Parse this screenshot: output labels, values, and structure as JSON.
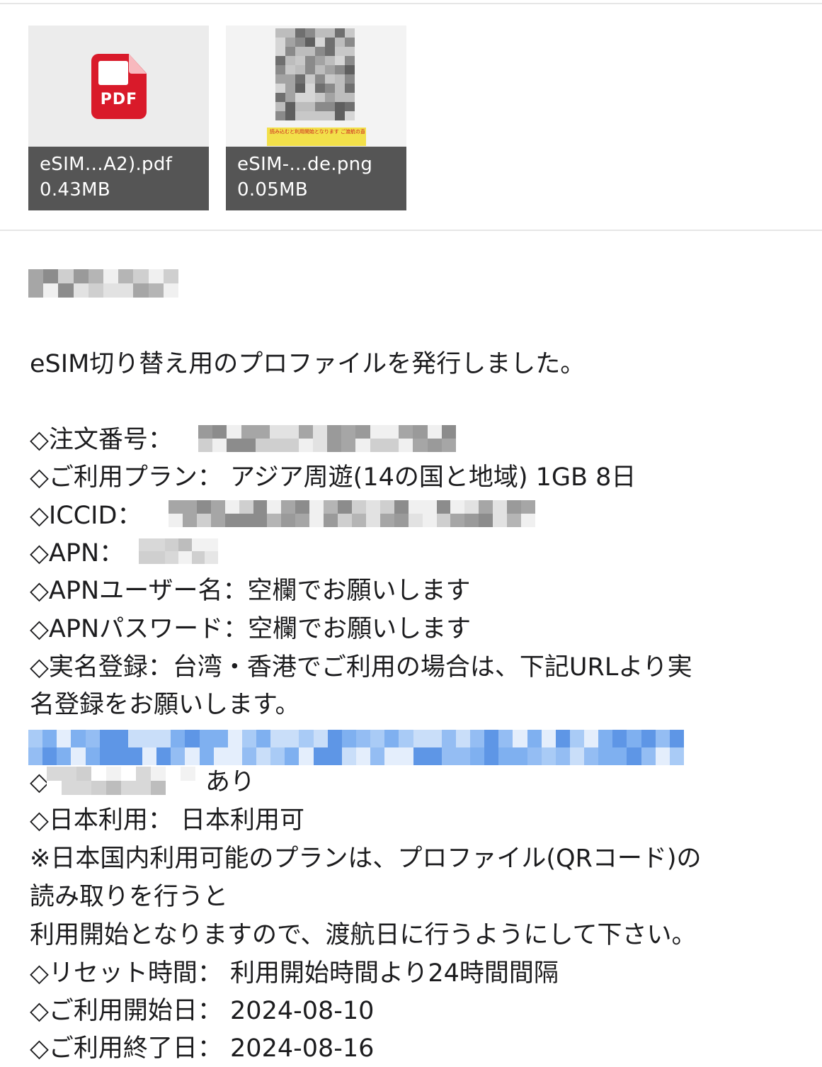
{
  "attachments": [
    {
      "type": "pdf",
      "icon": "pdf-icon",
      "icon_label": "PDF",
      "name": "eSIM…A2).pdf",
      "size": "0.43MB"
    },
    {
      "type": "png",
      "icon": "image-thumbnail",
      "name": "eSIM-...de.png",
      "size": "0.05MB",
      "preview_caption": "読み込むと利用開始となります ご渡航の直前直後に設定して下さい"
    }
  ],
  "message": {
    "intro": "eSIM切り替え用のプロファイルを発行しました。",
    "lines": [
      "◇注文番号：",
      "◇ご利用プラン： アジア周遊(14の国と地域) 1GB 8日",
      "◇ICCID：",
      "◇APN：",
      "◇APNユーザー名：空欄でお願いします",
      "◇APNパスワード：空欄でお願いします",
      "◇実名登録：台湾・香港でご利用の場合は、下記URLより実",
      "名登録をお願いします。",
      "◇テザリング： あり",
      "◇日本利用： 日本利用可",
      "※日本国内利用可能のプランは、プロファイル(QRコード)の",
      "読み取りを行うと",
      "利用開始となりますので、渡航日に行うようにして下さい。",
      "◇リセット時間： 利用開始時間より24時間間隔",
      "◇ご利用開始日： 2024-08-10",
      "◇ご利用終了日： 2024-08-16"
    ]
  },
  "colors": {
    "pdf_red": "#d91a2a",
    "attachment_footer": "#555555",
    "link_blue": "#3d7fe0",
    "redaction_gray": "#a8a8a8"
  }
}
